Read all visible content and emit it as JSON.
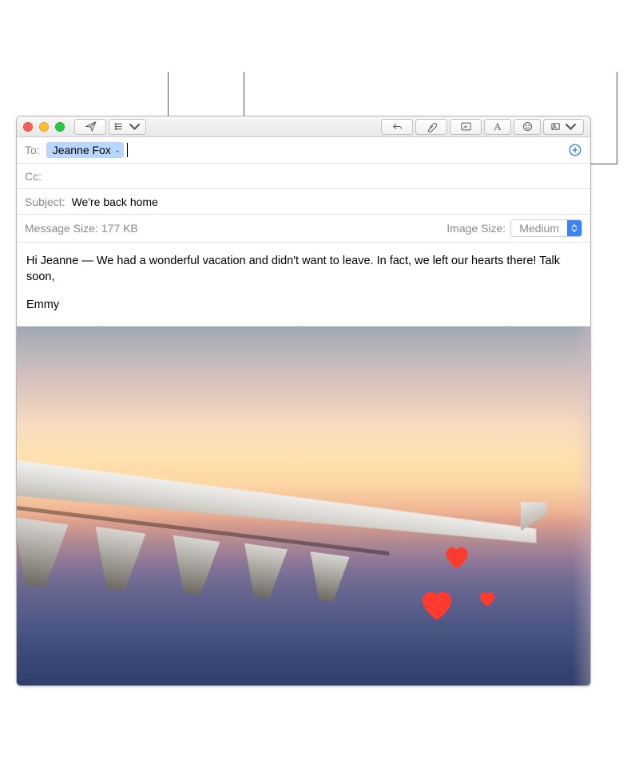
{
  "toolbar": {
    "send_name": "send-button",
    "headers_menu_name": "header-fields-menu-button",
    "reply_name": "reply-button",
    "attach_name": "attach-button",
    "markup_name": "markup-button",
    "format_name": "format-button",
    "emoji_name": "emoji-picker-button",
    "photos_name": "photo-browser-button"
  },
  "fields": {
    "to_label": "To:",
    "to_recipient": "Jeanne Fox",
    "cc_label": "Cc:",
    "subject_label": "Subject:",
    "subject_value": "We're back home",
    "message_size_label": "Message Size:",
    "message_size_value": "177 KB",
    "image_size_label": "Image Size:",
    "image_size_value": "Medium"
  },
  "body": {
    "paragraph1": "Hi Jeanne — We had a wonderful vacation and didn't want to leave. In fact, we left our hearts there! Talk soon,",
    "signature": "Emmy"
  }
}
